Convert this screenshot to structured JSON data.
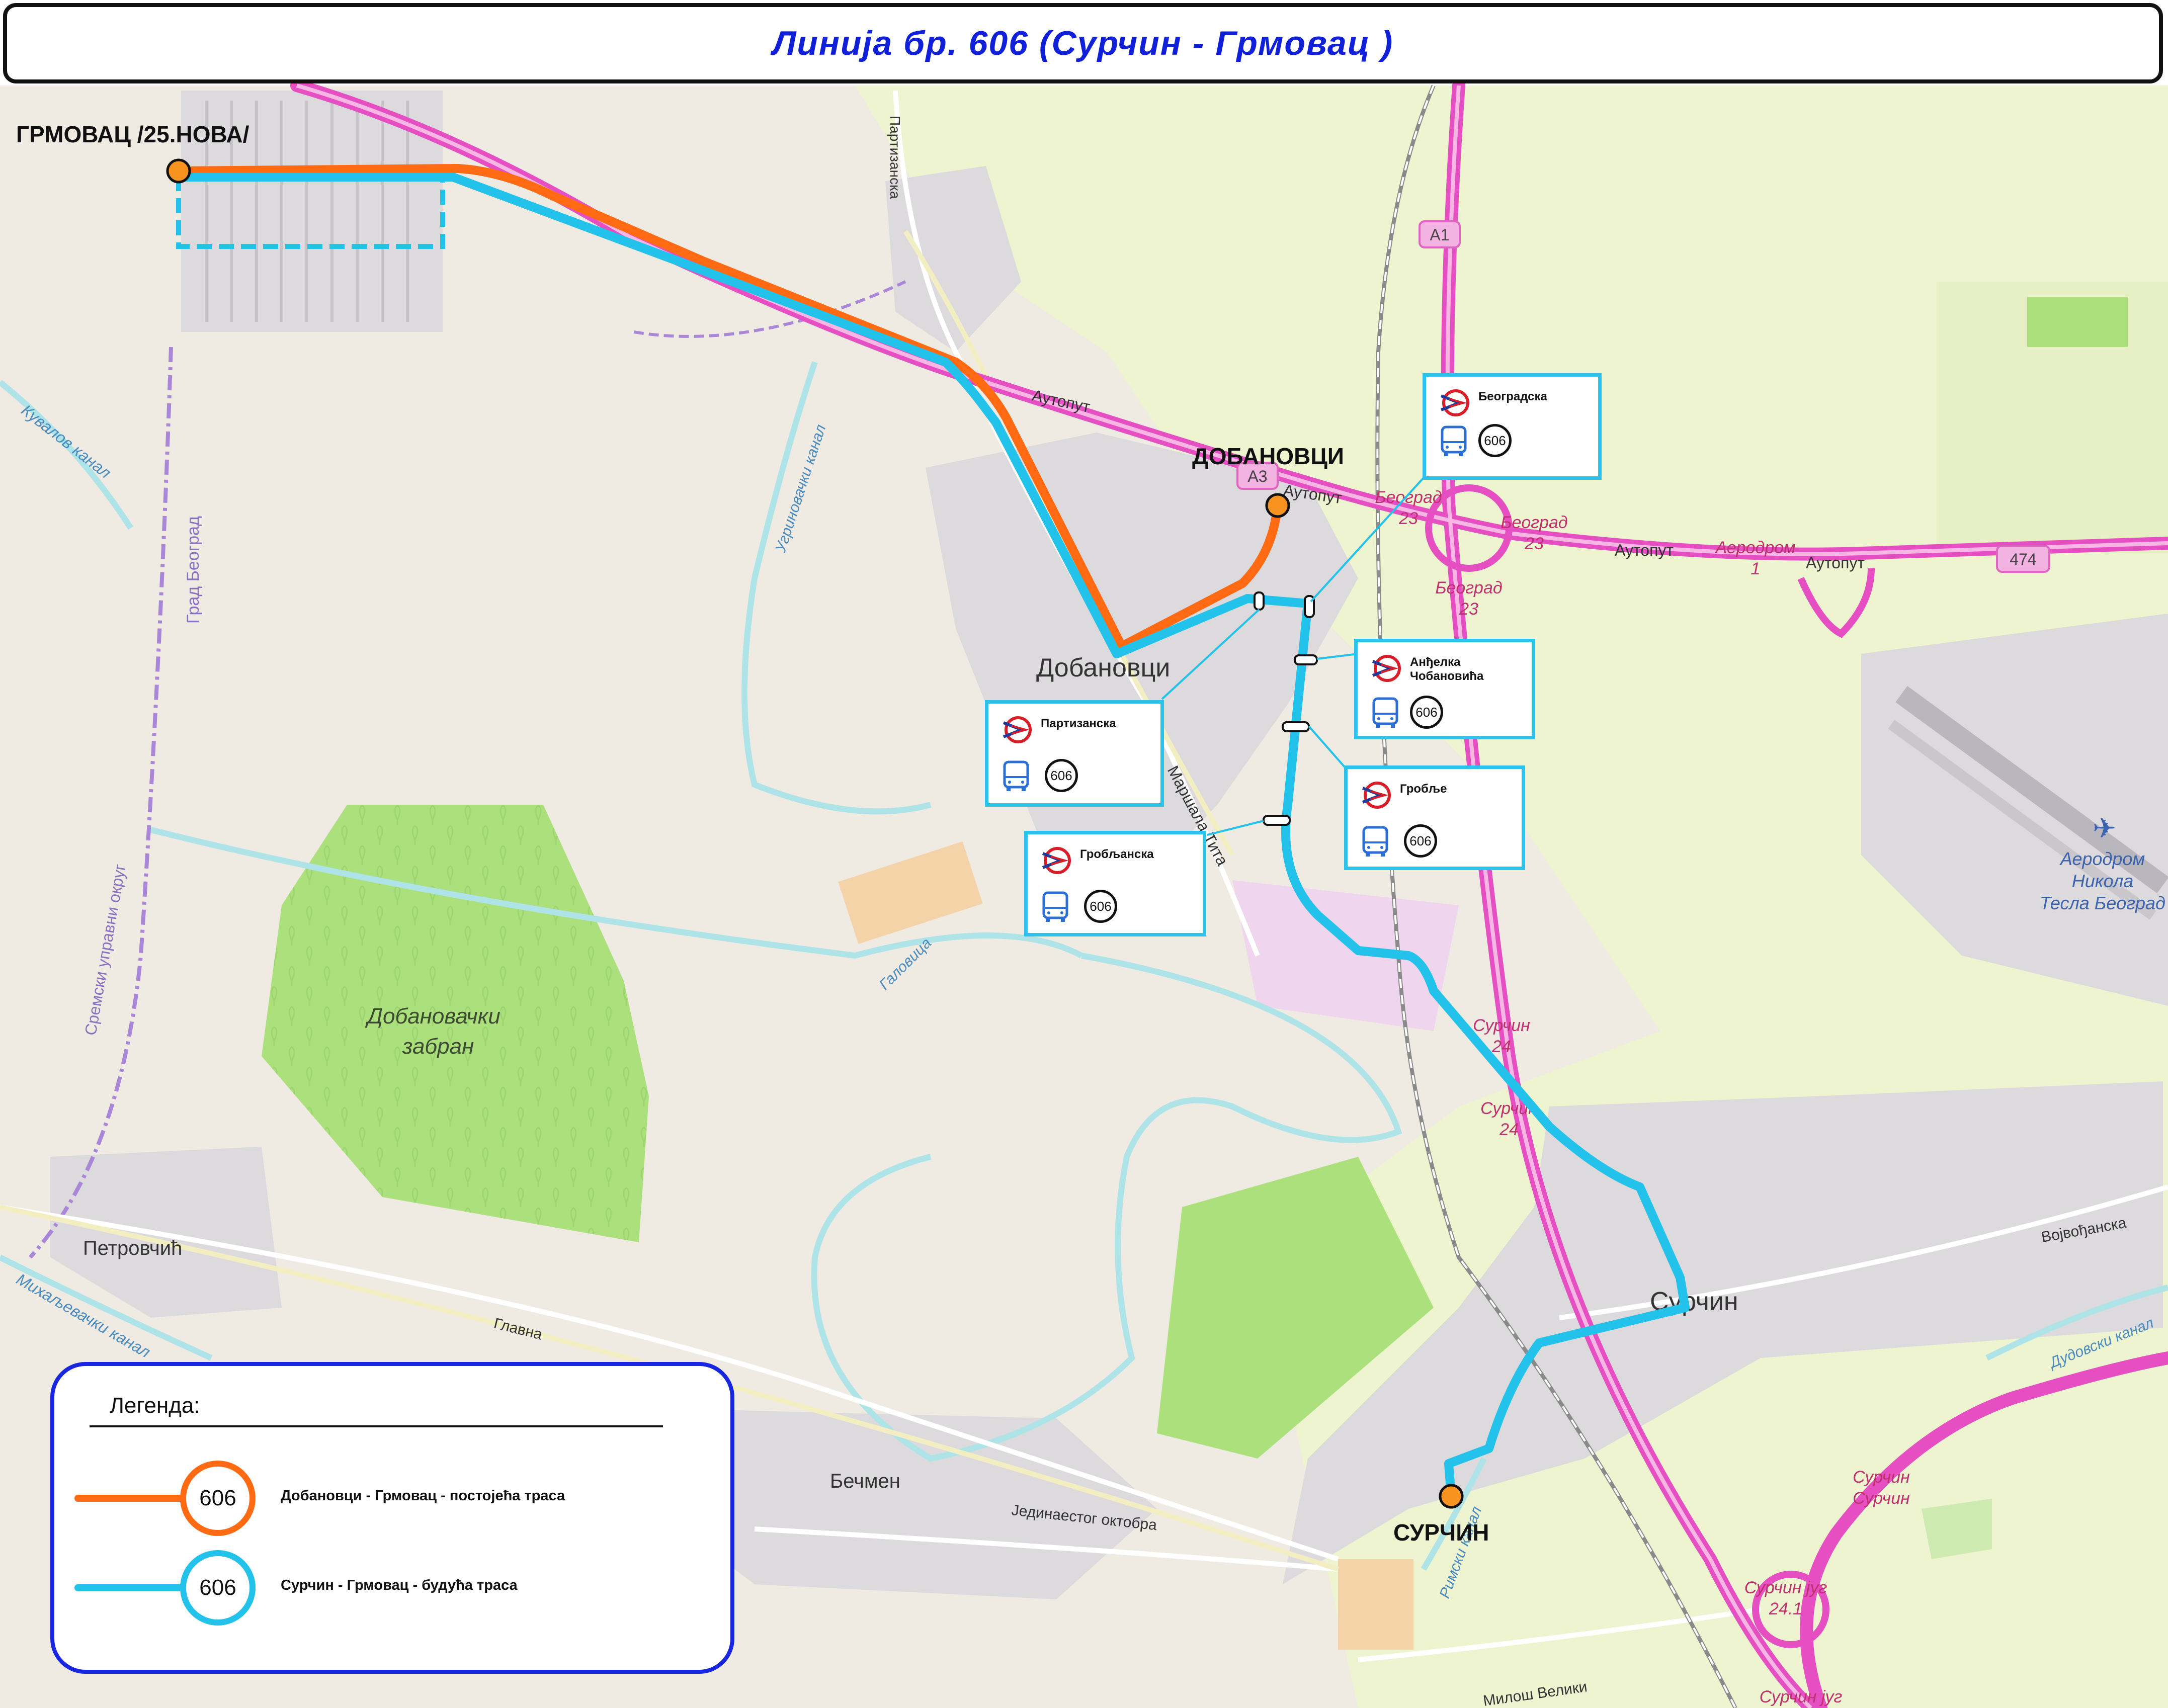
{
  "title": "Линија бр. 606 (Сурчин - Грмовац )",
  "colors": {
    "existing_route": "#ff6a13",
    "future_route": "#22c2ea",
    "highway": "#e64fc2",
    "terminal": "#f7931e",
    "title_text": "#1020d8",
    "legend_border": "#1826e0"
  },
  "terminals": [
    {
      "name": "ГРМОВАЦ /25.НОВА/"
    },
    {
      "name": "ДОБАНОВЦИ"
    },
    {
      "name": "СУРЧИН"
    }
  ],
  "stops": [
    {
      "name": "Београдска",
      "route": "606",
      "icons": [
        "transit-logo-icon",
        "bus-icon"
      ]
    },
    {
      "name": "Анђелка\nЧобановића",
      "route": "606",
      "icons": [
        "transit-logo-icon",
        "bus-icon"
      ]
    },
    {
      "name": "Партизанска",
      "route": "606",
      "icons": [
        "transit-logo-icon",
        "bus-icon"
      ]
    },
    {
      "name": "Гробље",
      "route": "606",
      "icons": [
        "transit-logo-icon",
        "bus-icon"
      ]
    },
    {
      "name": "Гробљанска",
      "route": "606",
      "icons": [
        "transit-logo-icon",
        "bus-icon"
      ]
    }
  ],
  "map_labels": {
    "places": [
      "Добановци",
      "Сурчин",
      "Петровчић",
      "Бечмен",
      "Аеродром\nНикола\nТесла Београд"
    ],
    "forest": [
      "Добановачки",
      "забран"
    ],
    "roads": [
      "Аутопут",
      "Аутопут",
      "Аутопут",
      "Аутопут",
      "Партизанска",
      "Маршала Тита",
      "Главна",
      "Јединаестог октобра",
      "Војвођанска",
      "Милош Велики"
    ],
    "road_shields": [
      "A1",
      "A3",
      "474"
    ],
    "waterways": [
      "Кувалов канал",
      "Угриновачки канал",
      "Галовица",
      "Михаљевачки канал",
      "Римски канал",
      "Дудовски канал"
    ],
    "boundaries": [
      "Град Београд",
      "Сремски управни округ"
    ],
    "interchanges": [
      "Београд\n23",
      "Београд\n23",
      "Београд\n23",
      "Аеродром\n1",
      "Сурчин\n24",
      "Сурчин\n24",
      "Сурчин\nСурчин",
      "Сурчин југ\n24.1",
      "Сурчин југ"
    ]
  },
  "legend": {
    "title": "Легенда:",
    "items": [
      {
        "badge": "606",
        "label": "Добановци - Грмовац - постојећа траса",
        "type": "existing"
      },
      {
        "badge": "606",
        "label": "Сурчин - Грмовац - будућа траса",
        "type": "future"
      }
    ]
  }
}
